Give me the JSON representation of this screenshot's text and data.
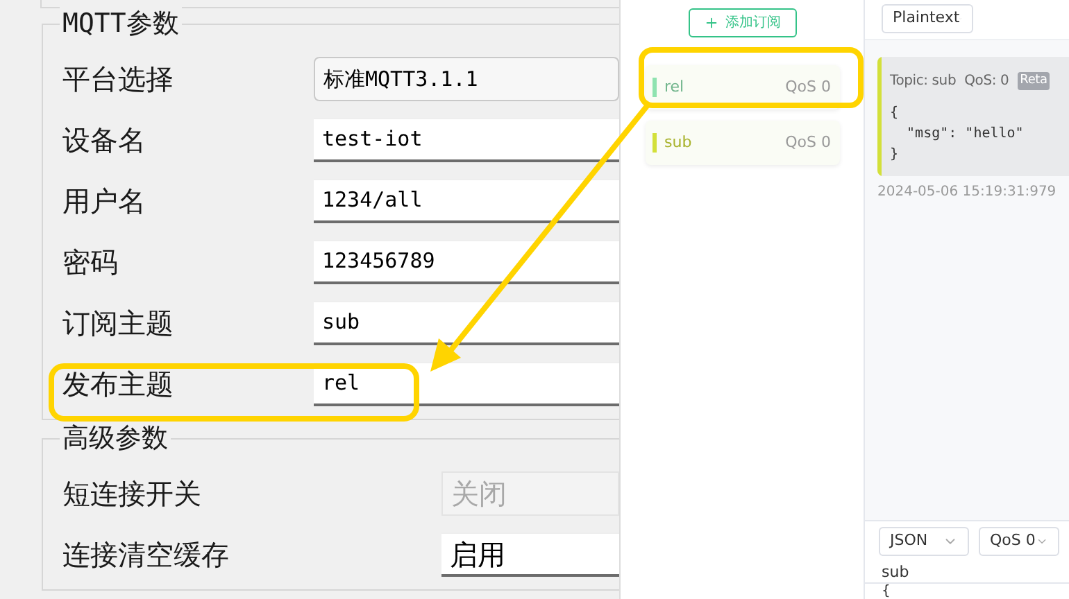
{
  "mqtt_group": {
    "title": "MQTT参数",
    "rows": [
      {
        "label": "平台选择",
        "value": "标准MQTT3.1.1",
        "kind": "select"
      },
      {
        "label": "设备名",
        "value": "test-iot",
        "kind": "input"
      },
      {
        "label": "用户名",
        "value": "1234/all",
        "kind": "input"
      },
      {
        "label": "密码",
        "value": "123456789",
        "kind": "input"
      },
      {
        "label": "订阅主题",
        "value": "sub",
        "kind": "input"
      },
      {
        "label": "发布主题",
        "value": "rel",
        "kind": "input"
      }
    ]
  },
  "advanced_group": {
    "title": "高级参数",
    "rows": [
      {
        "label": "短连接开关",
        "value": "关闭",
        "disabled": true
      },
      {
        "label": "连接清空缓存",
        "value": "启用",
        "disabled": false
      }
    ]
  },
  "add_subscription_button": "添加订阅",
  "subscriptions": [
    {
      "topic": "rel",
      "qos": "QoS 0",
      "color": "#8fe3b0"
    },
    {
      "topic": "sub",
      "qos": "QoS 0",
      "color": "#d3e03a"
    }
  ],
  "message_view": {
    "format": "Plaintext"
  },
  "messages": [
    {
      "topic": "Topic: sub",
      "qos": "QoS: 0",
      "badge": "Reta",
      "body": "{\n  \"msg\": \"hello\"\n}",
      "time": "2024-05-06 15:19:31:979",
      "color": "#d3e03a"
    }
  ],
  "publish_bar": {
    "format": "JSON",
    "qos": "QoS 0",
    "topic": "sub",
    "payload": "{"
  }
}
